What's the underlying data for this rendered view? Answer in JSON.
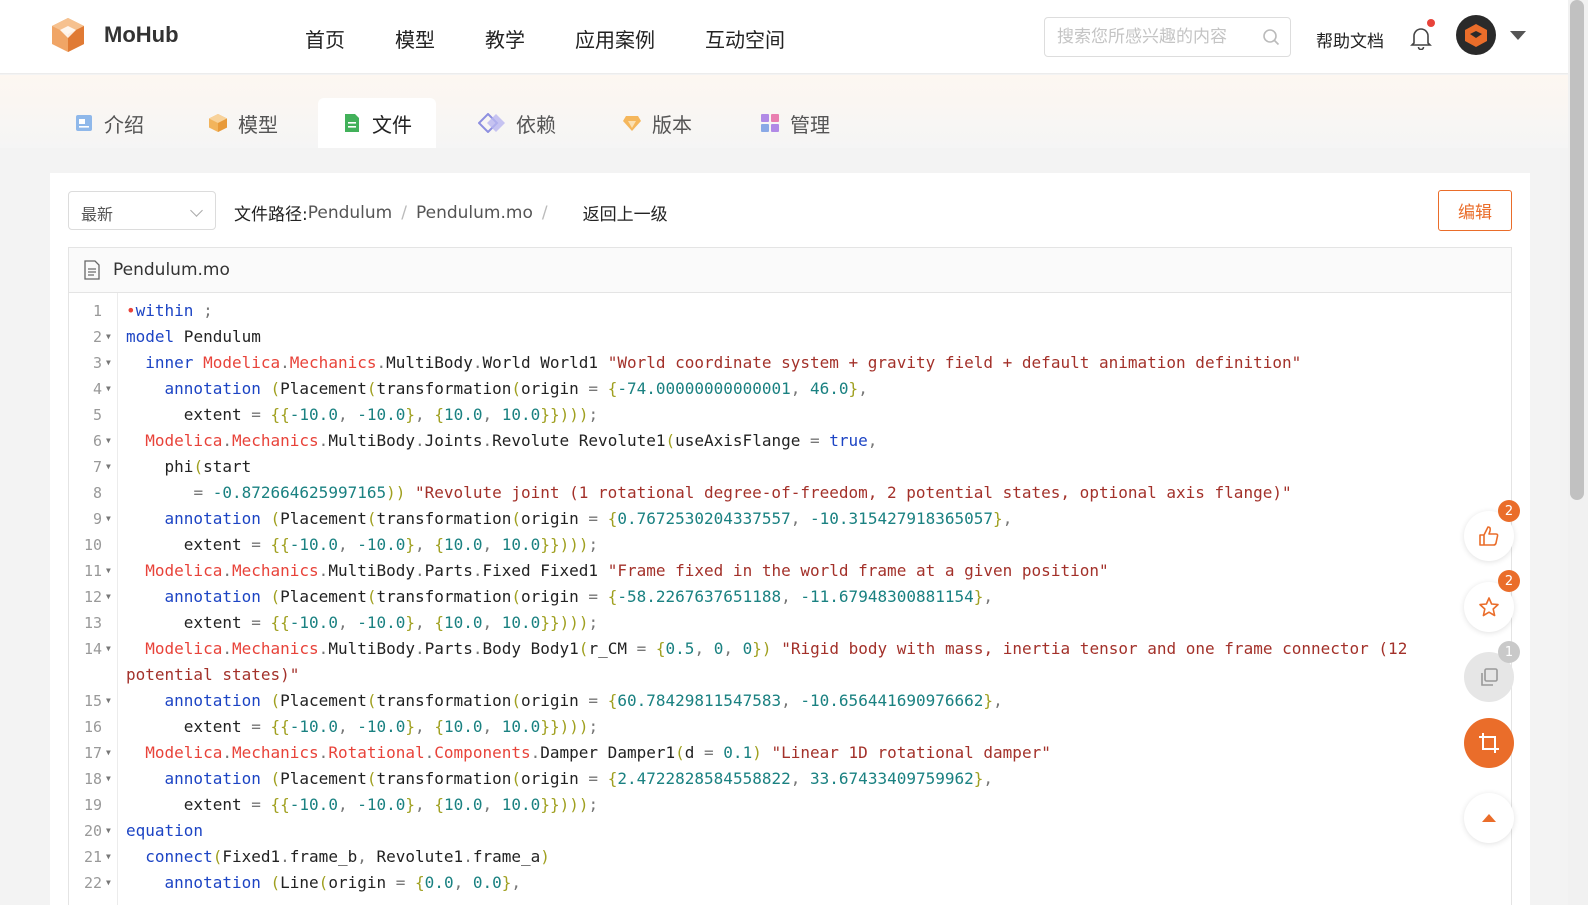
{
  "header": {
    "logo_text": "MoHub",
    "nav": [
      "首页",
      "模型",
      "教学",
      "应用案例",
      "互动空间"
    ],
    "search_placeholder": "搜索您所感兴趣的内容",
    "help_label": "帮助文档"
  },
  "tabs": [
    {
      "label": "介绍",
      "icon": "intro-icon",
      "active": false
    },
    {
      "label": "模型",
      "icon": "cube-icon",
      "active": false
    },
    {
      "label": "文件",
      "icon": "file-icon",
      "active": true
    },
    {
      "label": "依赖",
      "icon": "dependency-icon",
      "active": false
    },
    {
      "label": "版本",
      "icon": "diamond-icon",
      "active": false
    },
    {
      "label": "管理",
      "icon": "grid-icon",
      "active": false
    }
  ],
  "toolbar": {
    "version_value": "最新",
    "path_label": "文件路径:",
    "path_parts": [
      "Pendulum",
      "Pendulum.mo"
    ],
    "back_label": "返回上一级",
    "edit_label": "编辑"
  },
  "file": {
    "name": "Pendulum.mo",
    "line_numbers": [
      "1",
      "2",
      "3",
      "4",
      "5",
      "6",
      "7",
      "8",
      "9",
      "10",
      "11",
      "12",
      "13",
      "14",
      "15",
      "16",
      "17",
      "18",
      "19",
      "20",
      "21",
      "22"
    ],
    "foldable": [
      false,
      true,
      true,
      true,
      false,
      true,
      true,
      false,
      true,
      false,
      true,
      true,
      false,
      true,
      true,
      false,
      true,
      true,
      false,
      true,
      true,
      true
    ]
  },
  "floating": {
    "like_count": "2",
    "star_count": "2",
    "copy_count": "1"
  },
  "colors": {
    "accent": "#ea6d2a",
    "keyword": "#1c44c4",
    "module": "#e8433a",
    "string": "#a3312a",
    "number": "#1a8181"
  }
}
